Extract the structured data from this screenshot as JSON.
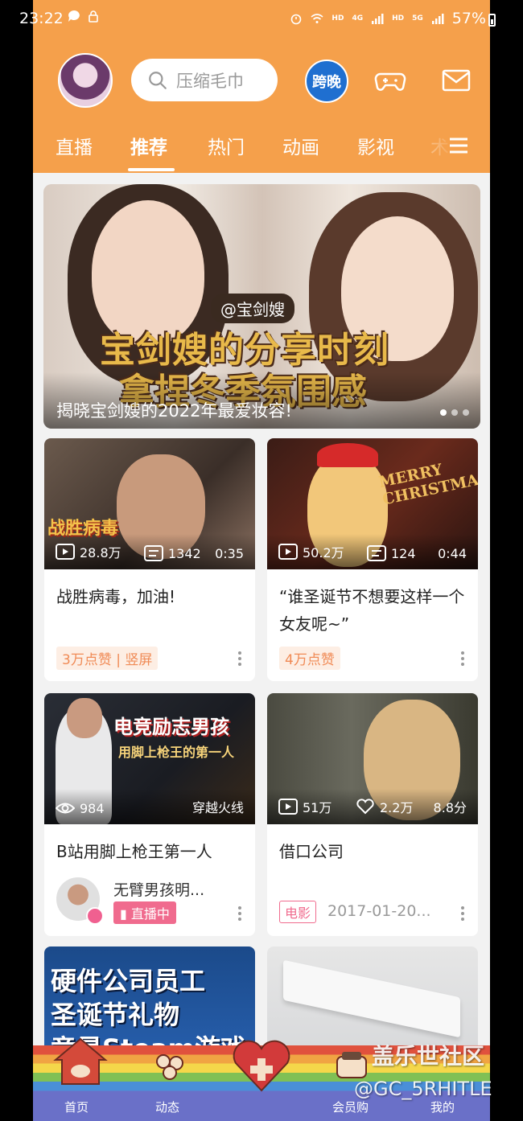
{
  "status_bar": {
    "time": "23:22",
    "battery": "57%",
    "net1": "HD",
    "net2": "4G",
    "net3": "HD",
    "net4": "5G"
  },
  "header": {
    "search_placeholder": "压缩毛巾",
    "badge": "跨晚"
  },
  "tabs": [
    {
      "label": "直播"
    },
    {
      "label": "推荐"
    },
    {
      "label": "热门"
    },
    {
      "label": "动画"
    },
    {
      "label": "影视"
    },
    {
      "label": "术"
    }
  ],
  "banner": {
    "tag": "@宝剑嫂",
    "title_line1": "宝剑嫂的分享时刻",
    "title_line2": "拿捏冬季氛围感",
    "caption": "揭晓宝剑嫂的2022年最爱妆容!"
  },
  "cards": [
    {
      "thumb_text": "战胜病毒",
      "views": "28.8万",
      "danmaku": "1342",
      "duration": "0:35",
      "title": "战胜病毒，加油!",
      "tag": "3万点赞 | 竖屏"
    },
    {
      "thumb_text": "MERRY CHRISTMAS",
      "views": "50.2万",
      "danmaku": "124",
      "duration": "0:44",
      "title": "“谁圣诞节不想要这样一个女友呢~”",
      "tag": "4万点赞"
    },
    {
      "thumb_text": "电竞励志男孩",
      "thumb_subtext": "用脚上枪王的第一人",
      "views": "984",
      "category": "穿越火线",
      "title": "B站用脚上枪王第一人",
      "uploader": "无臂男孩明...",
      "live": "直播中"
    },
    {
      "views": "51万",
      "likes": "2.2万",
      "score": "8.8分",
      "title": "借口公司",
      "tag": "电影",
      "date": "2017-01-20..."
    },
    {
      "thumb_text_1": "硬件公司员工",
      "thumb_text_2": "圣诞节礼物",
      "thumb_text_3": "竟是Steam游戏"
    },
    {}
  ],
  "bottom_nav": [
    {
      "label": "首页"
    },
    {
      "label": "动态"
    },
    {
      "label": "会员购"
    },
    {
      "label": "我的"
    }
  ],
  "watermark": {
    "line1": "盖乐世社区",
    "line2": "@GC_5RHITLE"
  },
  "colors": {
    "brand": "#f5a04b",
    "tag": "#f08a55"
  }
}
